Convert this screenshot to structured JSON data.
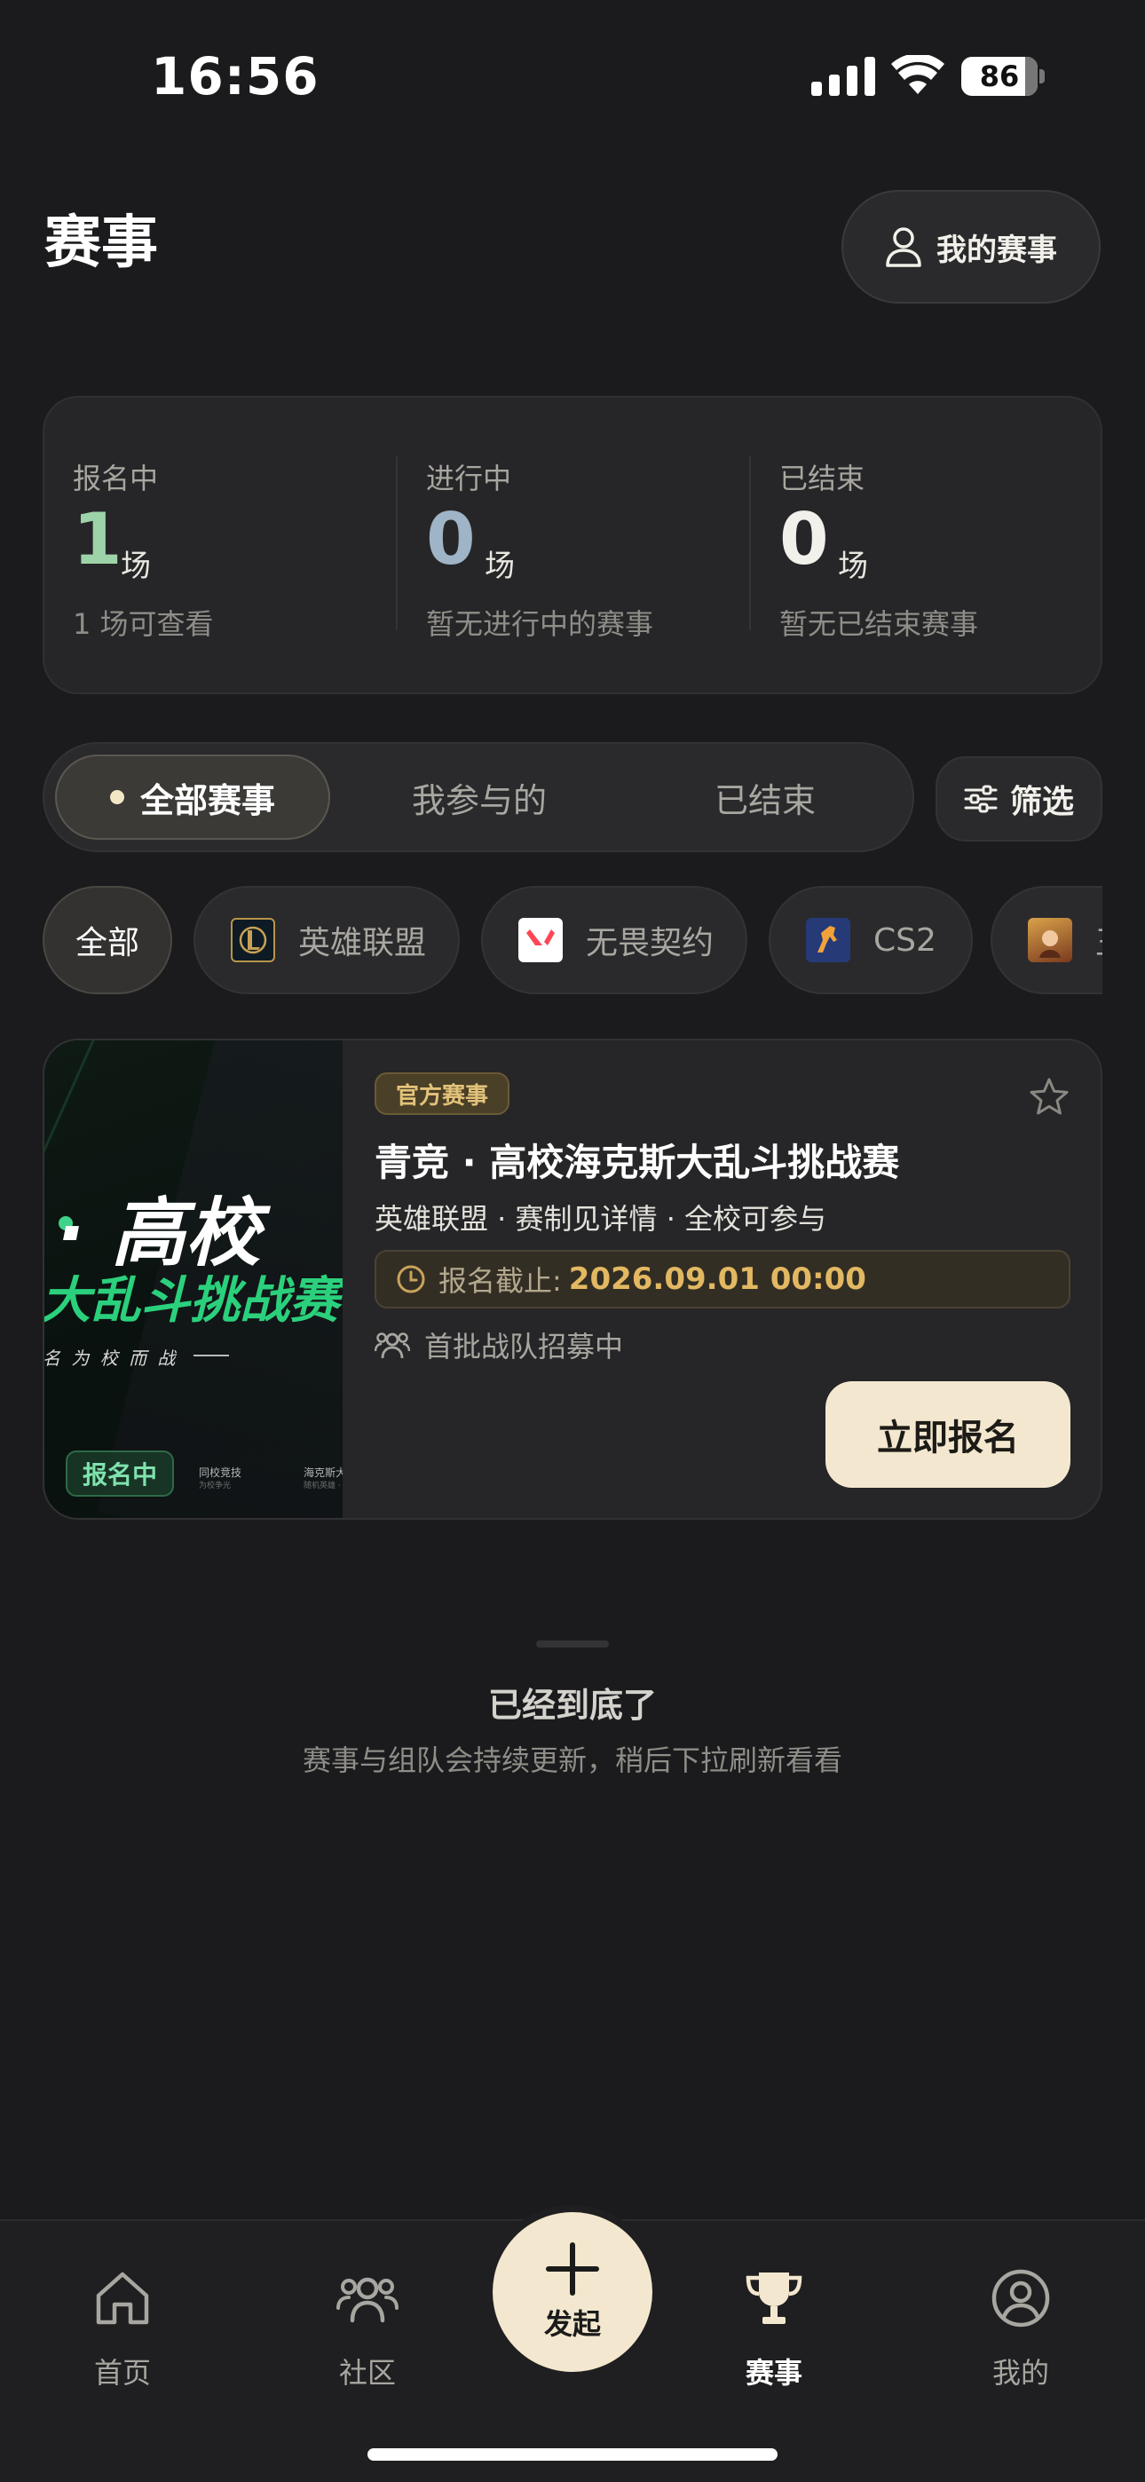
{
  "status_bar": {
    "time": "16:56",
    "battery": "86"
  },
  "header": {
    "title": "赛事",
    "my_events_label": "我的赛事"
  },
  "stats": [
    {
      "label": "报名中",
      "count": "1",
      "unit": "场",
      "desc": "1 场可查看",
      "color": "#9ed3a9"
    },
    {
      "label": "进行中",
      "count": "0",
      "unit": "场",
      "desc": "暂无进行中的赛事",
      "color": "#9fb4c6"
    },
    {
      "label": "已结束",
      "count": "0",
      "unit": "场",
      "desc": "暂无已结束赛事",
      "color": "#f2f0ea"
    }
  ],
  "tabs": {
    "all": "全部赛事",
    "joined": "我参与的",
    "ended": "已结束",
    "filter": "筛选"
  },
  "game_chips": [
    {
      "label": "全部",
      "icon": "none"
    },
    {
      "label": "英雄联盟",
      "icon": "league-of-legends-icon"
    },
    {
      "label": "无畏契约",
      "icon": "valorant-icon"
    },
    {
      "label": "CS2",
      "icon": "cs2-icon"
    },
    {
      "label": "王",
      "icon": "honor-of-kings-icon"
    }
  ],
  "event": {
    "tag": "官方赛事",
    "title": "青竞 · 高校海克斯大乱斗挑战赛",
    "meta": "英雄联盟 · 赛制见详情 · 全校可参与",
    "deadline_label": "报名截止:",
    "deadline_value": "2026.09.01 00:00",
    "recruit": "首批战队招募中",
    "signup_label": "立即报名",
    "poster": {
      "line1": "· 高校",
      "line2": "大乱斗挑战赛",
      "line3": "名  为 校 而 战",
      "status_badge": "报名中",
      "mini1_title": "同校竞技",
      "mini1_sub": "为校争光",
      "mini2_title": "海克斯大乱斗",
      "mini2_sub": "随机英雄 · 快"
    }
  },
  "end_of_list": {
    "title": "已经到底了",
    "desc": "赛事与组队会持续更新，稍后下拉刷新看看"
  },
  "bottom_nav": {
    "home": "首页",
    "community": "社区",
    "create": "发起",
    "events": "赛事",
    "mine": "我的"
  },
  "colors": {
    "accent": "#f3e8cf",
    "gold": "#e2b862",
    "green": "#2bd07c"
  }
}
